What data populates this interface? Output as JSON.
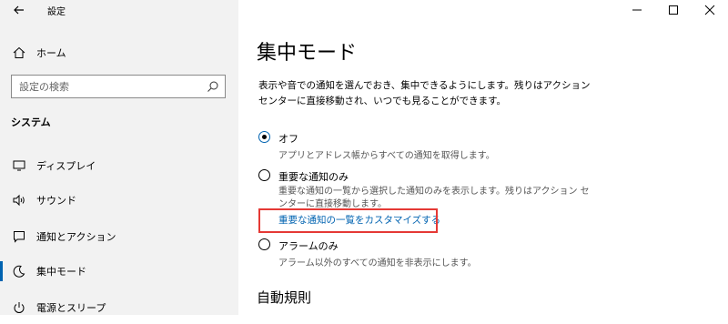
{
  "app": {
    "title": "設定"
  },
  "sidebar": {
    "home_label": "ホーム",
    "search_placeholder": "設定の検索",
    "section_label": "システム",
    "items": [
      {
        "label": "ディスプレイ",
        "icon": "monitor-icon"
      },
      {
        "label": "サウンド",
        "icon": "speaker-icon"
      },
      {
        "label": "通知とアクション",
        "icon": "notification-icon"
      },
      {
        "label": "集中モード",
        "icon": "moon-icon",
        "active": true
      },
      {
        "label": "電源とスリープ",
        "icon": "power-icon"
      }
    ]
  },
  "main": {
    "title": "集中モード",
    "description": "表示や音での通知を選んでおき、集中できるようにします。残りはアクション センターに直接移動され、いつでも見ることができます。",
    "options": [
      {
        "label": "オフ",
        "desc": "アプリとアドレス帳からすべての通知を取得します。",
        "checked": true
      },
      {
        "label": "重要な通知のみ",
        "desc": "重要な通知の一覧から選択した通知のみを表示します。残りはアクション センターに直接移動します。",
        "checked": false
      },
      {
        "label": "アラームのみ",
        "desc": "アラーム以外のすべての通知を非表示にします。",
        "checked": false
      }
    ],
    "customize_link": "重要な通知の一覧をカスタマイズする",
    "auto_rules_heading": "自動規則"
  },
  "colors": {
    "accent": "#0063b1",
    "highlight": "#e53935"
  }
}
